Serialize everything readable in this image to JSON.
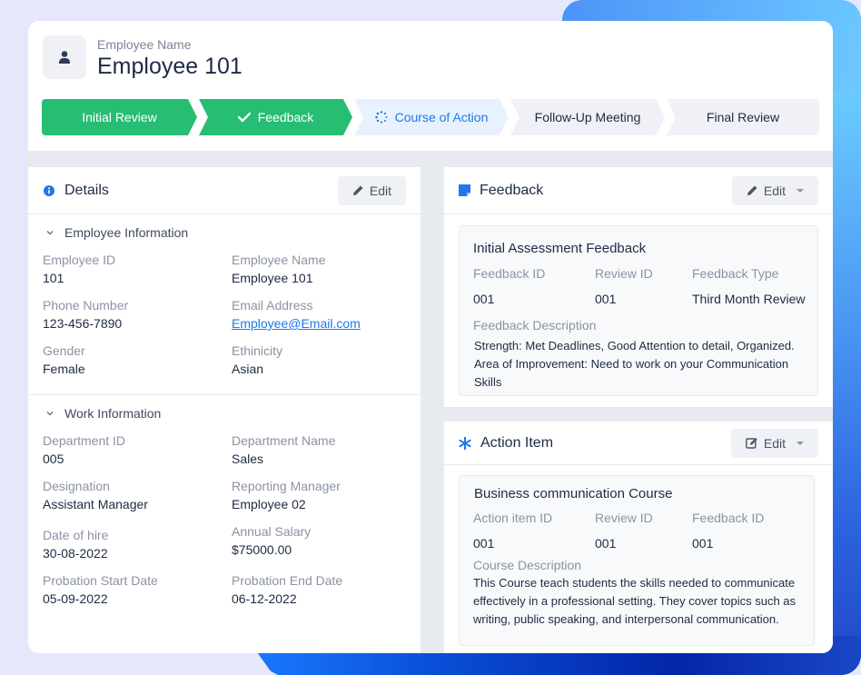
{
  "header": {
    "label": "Employee Name",
    "title": "Employee 101",
    "avatar_icon": "user-icon"
  },
  "steps": [
    {
      "label": "Initial Review",
      "status": "done",
      "icon": ""
    },
    {
      "label": "Feedback",
      "status": "done",
      "icon": "check-icon"
    },
    {
      "label": "Course of Action",
      "status": "active",
      "icon": "spinner-icon"
    },
    {
      "label": "Follow-Up Meeting",
      "status": "todo",
      "icon": ""
    },
    {
      "label": "Final Review",
      "status": "todo",
      "icon": ""
    }
  ],
  "details": {
    "title": "Details",
    "edit_label": "Edit",
    "employee_section": {
      "title": "Employee Information",
      "fields": [
        {
          "label": "Employee ID",
          "value": "101"
        },
        {
          "label": "Employee Name",
          "value": "Employee 101"
        },
        {
          "label": "Phone Number",
          "value": "123-456-7890"
        },
        {
          "label": "Email Address",
          "value": "Employee@Email.com"
        },
        {
          "label": "Gender",
          "value": "Female"
        },
        {
          "label": "Ethinicity",
          "value": "Asian"
        }
      ]
    },
    "work_section": {
      "title": "Work Information",
      "fields": [
        {
          "label": "Department ID",
          "value": "005"
        },
        {
          "label": "Department Name",
          "value": "Sales"
        },
        {
          "label": "Designation",
          "value": "Assistant Manager"
        },
        {
          "label": "Reporting Manager",
          "value": "Employee 02"
        },
        {
          "label": "Date of hire",
          "value": "30-08-2022"
        },
        {
          "label": "Annual Salary",
          "value": "$75000.00"
        },
        {
          "label": "Probation Start Date",
          "value": "05-09-2022"
        },
        {
          "label": "Probation End Date",
          "value": "06-12-2022"
        }
      ]
    }
  },
  "feedback": {
    "title": "Feedback",
    "edit_label": "Edit",
    "card": {
      "title": "Initial Assessment Feedback",
      "feedback_id_label": "Feedback ID",
      "feedback_id": "001",
      "review_id_label": "Review ID",
      "review_id": "001",
      "type_label": "Feedback Type",
      "type": "Third Month Review",
      "desc_label": "Feedback Description",
      "desc_line1": "Strength: Met Deadlines, Good Attention to detail, Organized.",
      "desc_line2": "Area of Improvement: Need to work on your Communication Skills"
    }
  },
  "action": {
    "title": "Action Item",
    "edit_label": "Edit",
    "card": {
      "title": "Business communication Course",
      "action_id_label": "Action item ID",
      "action_id": "001",
      "review_id_label": "Review ID",
      "review_id": "001",
      "feedback_id_label": "Feedback ID",
      "feedback_id": "001",
      "desc_label": "Course Description",
      "desc": "This Course teach students the skills needed to communicate effectively in a professional setting. They cover topics such as writing, public speaking, and interpersonal communication."
    }
  },
  "colors": {
    "done": "#27bd73",
    "active": "#1f79e8",
    "accent": "#1f79e8"
  }
}
